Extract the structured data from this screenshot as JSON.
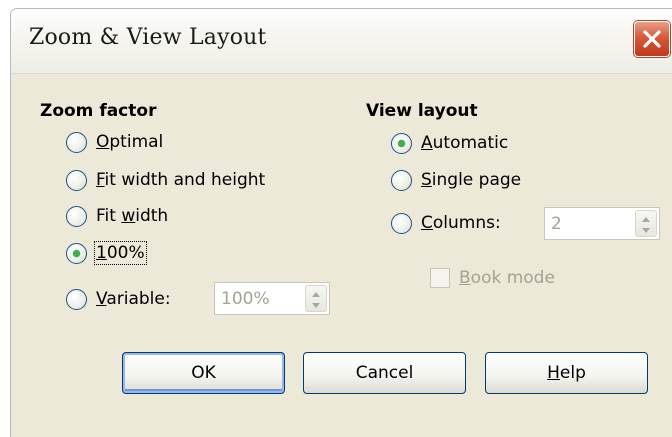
{
  "window": {
    "title": "Zoom & View Layout"
  },
  "zoom": {
    "heading": "Zoom factor",
    "options": [
      {
        "label": "Optimal",
        "selected": false
      },
      {
        "label": "Fit width and height",
        "selected": false
      },
      {
        "label": "Fit width",
        "selected": false
      },
      {
        "label": "100%",
        "selected": true
      },
      {
        "label": "Variable:",
        "selected": false
      }
    ],
    "variable_value": "100%"
  },
  "view": {
    "heading": "View layout",
    "options": [
      {
        "label": "Automatic",
        "selected": true
      },
      {
        "label": "Single page",
        "selected": false
      },
      {
        "label": "Columns:",
        "selected": false
      }
    ],
    "columns_value": "2",
    "book_mode_label": "Book mode",
    "book_mode_checked": false
  },
  "buttons": {
    "ok": "OK",
    "cancel": "Cancel",
    "help": "Help"
  },
  "colors": {
    "title_close": "#d8593b",
    "radio_dot": "#38b14a",
    "dialog_bg": "#ece9d8"
  }
}
